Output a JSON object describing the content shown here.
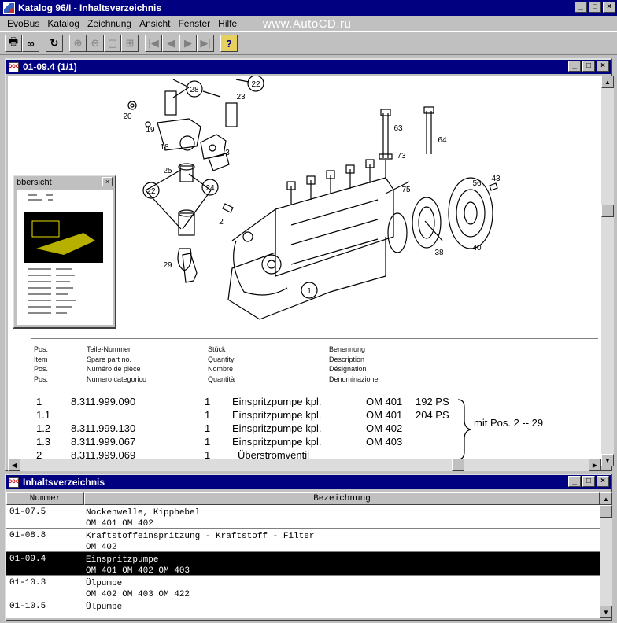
{
  "window": {
    "title": "Katalog 96/I - Inhaltsverzeichnis"
  },
  "watermark": "www.AutoCD.ru",
  "menu": [
    "EvoBus",
    "Katalog",
    "Zeichnung",
    "Ansicht",
    "Fenster",
    "Hilfe"
  ],
  "drawing_window": {
    "title": "01-09.4 (1/1)"
  },
  "overview": {
    "title": "bbersicht"
  },
  "callouts": [
    "20",
    "19",
    "28",
    "22",
    "23",
    "18",
    "3",
    "63",
    "64",
    "73",
    "25",
    "22",
    "24",
    "2",
    "29",
    "75",
    "56",
    "43",
    "38",
    "40",
    "1"
  ],
  "parts_header": {
    "pos": [
      "Pos.",
      "Item",
      "Pos.",
      "Pos."
    ],
    "part_no": [
      "Teile-Nummer",
      "Spare part no.",
      "Numéro de pièce",
      "Numero categorico"
    ],
    "qty": [
      "Stück",
      "Quantity",
      "Nombre",
      "Quantità"
    ],
    "desc": [
      "Benennung",
      "Description",
      "Désignation",
      "Denominazione"
    ]
  },
  "parts": [
    {
      "pos": "1",
      "number": "8.311.999.090",
      "qty": "1",
      "name": "Einspritzpumpe kpl.",
      "model": "OM 401",
      "ps": "192 PS"
    },
    {
      "pos": "1.1",
      "number": "",
      "qty": "1",
      "name": "Einspritzpumpe kpl.",
      "model": "OM 401",
      "ps": "204 PS"
    },
    {
      "pos": "1.2",
      "number": "8.311.999.130",
      "qty": "1",
      "name": "Einspritzpumpe kpl.",
      "model": "OM 402",
      "ps": ""
    },
    {
      "pos": "1.3",
      "number": "8.311.999.067",
      "qty": "1",
      "name": "Einspritzpumpe kpl.",
      "model": "OM 403",
      "ps": ""
    },
    {
      "pos": "2",
      "number": "8.311.999.069",
      "qty": "1",
      "name": "Überströmventil",
      "model": "",
      "ps": ""
    }
  ],
  "parts_note": "mit Pos. 2 -- 29",
  "index_window": {
    "title": "Inhaltsverzeichnis"
  },
  "index_columns": [
    "Nummer",
    "Bezeichnung"
  ],
  "index_rows": [
    {
      "number": "01-07.5",
      "line1": "Nockenwelle, Kipphebel",
      "line2": "OM 401   OM 402",
      "selected": false
    },
    {
      "number": "01-08.8",
      "line1": "Kraftstoffeinspritzung - Kraftstoff - Filter",
      "line2": "OM 402",
      "selected": false
    },
    {
      "number": "01-09.4",
      "line1": "Einspritzpumpe",
      "line2": "OM 401   OM 402   OM 403",
      "selected": true
    },
    {
      "number": "01-10.3",
      "line1": "Ülpumpe",
      "line2": "OM 402   OM 403   OM 422",
      "selected": false
    },
    {
      "number": "01-10.5",
      "line1": "Ülpumpe",
      "line2": "",
      "selected": false
    }
  ]
}
